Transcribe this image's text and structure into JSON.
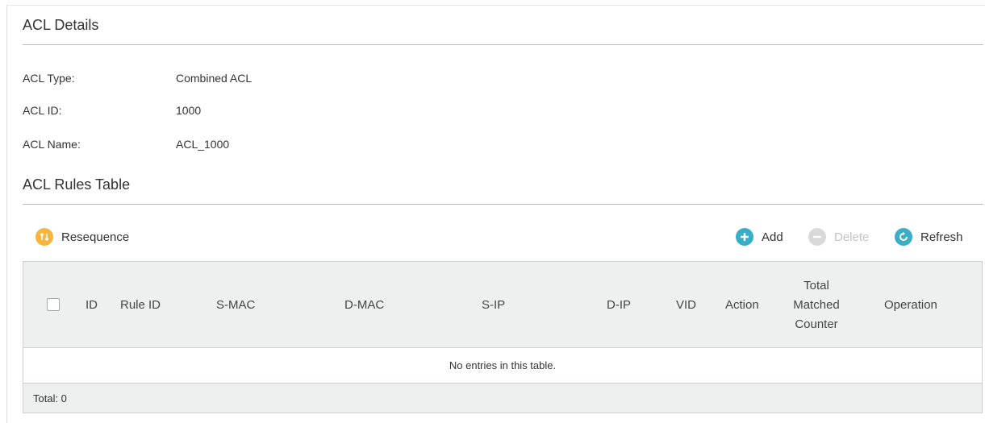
{
  "details": {
    "title": "ACL Details",
    "fields": [
      {
        "label": "ACL Type:",
        "value": "Combined ACL"
      },
      {
        "label": "ACL ID:",
        "value": "1000"
      },
      {
        "label": "ACL Name:",
        "value": "ACL_1000"
      }
    ]
  },
  "rules_table": {
    "title": "ACL Rules Table",
    "toolbar": {
      "resequence_label": "Resequence",
      "add_label": "Add",
      "delete_label": "Delete",
      "refresh_label": "Refresh"
    },
    "columns": {
      "id": "ID",
      "rule_id": "Rule ID",
      "s_mac": "S-MAC",
      "d_mac": "D-MAC",
      "s_ip": "S-IP",
      "d_ip": "D-IP",
      "vid": "VID",
      "action": "Action",
      "total_line1": "Total",
      "total_line2": "Matched",
      "total_line3": "Counter",
      "operation": "Operation"
    },
    "empty_message": "No entries in this table.",
    "total_text": "Total: 0"
  },
  "colors": {
    "resequence_icon": "#f5b53f",
    "add_icon": "#3aaec6",
    "delete_icon": "#d9d9d9",
    "refresh_icon": "#3aaec6",
    "header_bg": "#eef0f0"
  },
  "icons": {
    "resequence": "resequence-icon",
    "add": "plus-circle-icon",
    "delete": "minus-circle-icon",
    "refresh": "refresh-icon"
  }
}
